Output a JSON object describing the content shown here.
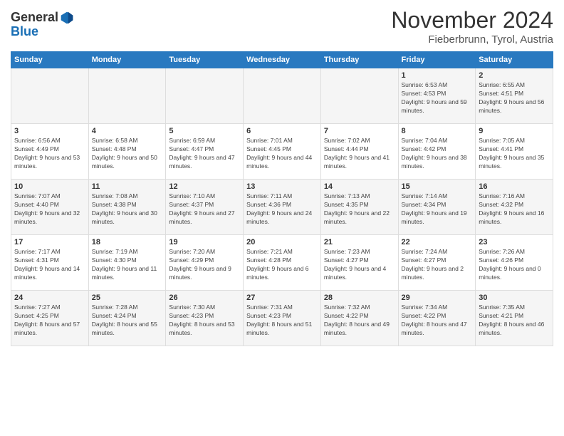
{
  "header": {
    "logo_general": "General",
    "logo_blue": "Blue",
    "month_title": "November 2024",
    "subtitle": "Fieberbrunn, Tyrol, Austria"
  },
  "calendar": {
    "days_of_week": [
      "Sunday",
      "Monday",
      "Tuesday",
      "Wednesday",
      "Thursday",
      "Friday",
      "Saturday"
    ],
    "weeks": [
      [
        {
          "day": "",
          "info": ""
        },
        {
          "day": "",
          "info": ""
        },
        {
          "day": "",
          "info": ""
        },
        {
          "day": "",
          "info": ""
        },
        {
          "day": "",
          "info": ""
        },
        {
          "day": "1",
          "info": "Sunrise: 6:53 AM\nSunset: 4:53 PM\nDaylight: 9 hours and 59 minutes."
        },
        {
          "day": "2",
          "info": "Sunrise: 6:55 AM\nSunset: 4:51 PM\nDaylight: 9 hours and 56 minutes."
        }
      ],
      [
        {
          "day": "3",
          "info": "Sunrise: 6:56 AM\nSunset: 4:49 PM\nDaylight: 9 hours and 53 minutes."
        },
        {
          "day": "4",
          "info": "Sunrise: 6:58 AM\nSunset: 4:48 PM\nDaylight: 9 hours and 50 minutes."
        },
        {
          "day": "5",
          "info": "Sunrise: 6:59 AM\nSunset: 4:47 PM\nDaylight: 9 hours and 47 minutes."
        },
        {
          "day": "6",
          "info": "Sunrise: 7:01 AM\nSunset: 4:45 PM\nDaylight: 9 hours and 44 minutes."
        },
        {
          "day": "7",
          "info": "Sunrise: 7:02 AM\nSunset: 4:44 PM\nDaylight: 9 hours and 41 minutes."
        },
        {
          "day": "8",
          "info": "Sunrise: 7:04 AM\nSunset: 4:42 PM\nDaylight: 9 hours and 38 minutes."
        },
        {
          "day": "9",
          "info": "Sunrise: 7:05 AM\nSunset: 4:41 PM\nDaylight: 9 hours and 35 minutes."
        }
      ],
      [
        {
          "day": "10",
          "info": "Sunrise: 7:07 AM\nSunset: 4:40 PM\nDaylight: 9 hours and 32 minutes."
        },
        {
          "day": "11",
          "info": "Sunrise: 7:08 AM\nSunset: 4:38 PM\nDaylight: 9 hours and 30 minutes."
        },
        {
          "day": "12",
          "info": "Sunrise: 7:10 AM\nSunset: 4:37 PM\nDaylight: 9 hours and 27 minutes."
        },
        {
          "day": "13",
          "info": "Sunrise: 7:11 AM\nSunset: 4:36 PM\nDaylight: 9 hours and 24 minutes."
        },
        {
          "day": "14",
          "info": "Sunrise: 7:13 AM\nSunset: 4:35 PM\nDaylight: 9 hours and 22 minutes."
        },
        {
          "day": "15",
          "info": "Sunrise: 7:14 AM\nSunset: 4:34 PM\nDaylight: 9 hours and 19 minutes."
        },
        {
          "day": "16",
          "info": "Sunrise: 7:16 AM\nSunset: 4:32 PM\nDaylight: 9 hours and 16 minutes."
        }
      ],
      [
        {
          "day": "17",
          "info": "Sunrise: 7:17 AM\nSunset: 4:31 PM\nDaylight: 9 hours and 14 minutes."
        },
        {
          "day": "18",
          "info": "Sunrise: 7:19 AM\nSunset: 4:30 PM\nDaylight: 9 hours and 11 minutes."
        },
        {
          "day": "19",
          "info": "Sunrise: 7:20 AM\nSunset: 4:29 PM\nDaylight: 9 hours and 9 minutes."
        },
        {
          "day": "20",
          "info": "Sunrise: 7:21 AM\nSunset: 4:28 PM\nDaylight: 9 hours and 6 minutes."
        },
        {
          "day": "21",
          "info": "Sunrise: 7:23 AM\nSunset: 4:27 PM\nDaylight: 9 hours and 4 minutes."
        },
        {
          "day": "22",
          "info": "Sunrise: 7:24 AM\nSunset: 4:27 PM\nDaylight: 9 hours and 2 minutes."
        },
        {
          "day": "23",
          "info": "Sunrise: 7:26 AM\nSunset: 4:26 PM\nDaylight: 9 hours and 0 minutes."
        }
      ],
      [
        {
          "day": "24",
          "info": "Sunrise: 7:27 AM\nSunset: 4:25 PM\nDaylight: 8 hours and 57 minutes."
        },
        {
          "day": "25",
          "info": "Sunrise: 7:28 AM\nSunset: 4:24 PM\nDaylight: 8 hours and 55 minutes."
        },
        {
          "day": "26",
          "info": "Sunrise: 7:30 AM\nSunset: 4:23 PM\nDaylight: 8 hours and 53 minutes."
        },
        {
          "day": "27",
          "info": "Sunrise: 7:31 AM\nSunset: 4:23 PM\nDaylight: 8 hours and 51 minutes."
        },
        {
          "day": "28",
          "info": "Sunrise: 7:32 AM\nSunset: 4:22 PM\nDaylight: 8 hours and 49 minutes."
        },
        {
          "day": "29",
          "info": "Sunrise: 7:34 AM\nSunset: 4:22 PM\nDaylight: 8 hours and 47 minutes."
        },
        {
          "day": "30",
          "info": "Sunrise: 7:35 AM\nSunset: 4:21 PM\nDaylight: 8 hours and 46 minutes."
        }
      ]
    ]
  }
}
